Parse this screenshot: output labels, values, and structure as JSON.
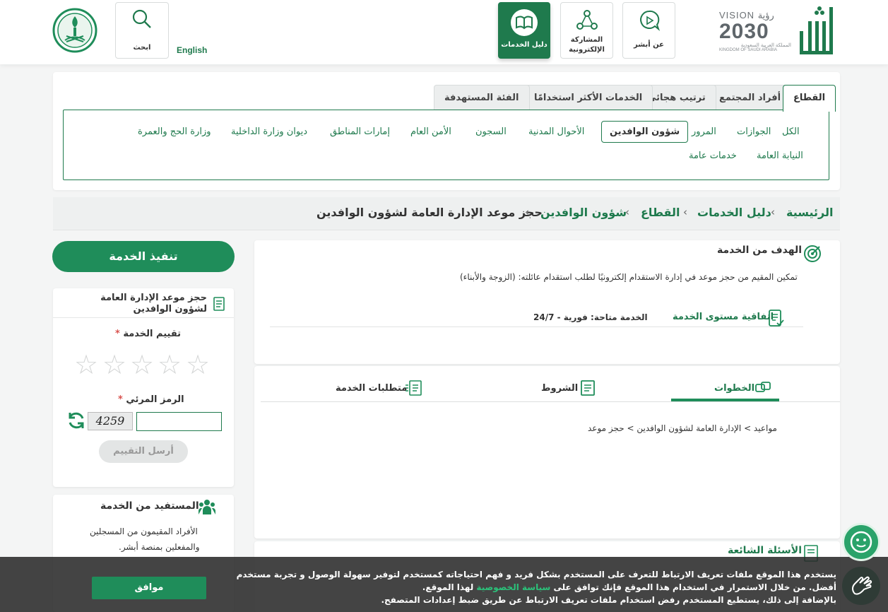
{
  "header": {
    "nav": {
      "about": "عن أبشر",
      "eparticipation": "المشاركة الإلكترونية",
      "services_guide": "دليل الخدمات",
      "search": "ابحث",
      "language": "English"
    },
    "vision": {
      "line1": "VISION رؤية",
      "line2": "2030",
      "line3": "المملكة العربية السعودية",
      "line4": "KINGDOM OF SAUDI ARABIA"
    }
  },
  "sector": {
    "tabs": [
      "القطاع",
      "أفراد المجتمع",
      "ترتيب هجائي",
      "الخدمات الأكثر استخدامًا",
      "الفئة المستهدفة"
    ],
    "chips_row1": [
      "الكل",
      "الجوازات",
      "المرور",
      "شؤون الوافدين",
      "الأحوال المدنية",
      "السجون",
      "الأمن العام",
      "إمارات المناطق",
      "ديوان وزارة الداخلية",
      "وزارة الحج والعمرة"
    ],
    "chips_row2": [
      "النيابة العامة",
      "خدمات عامة"
    ]
  },
  "breadcrumb": {
    "home": "الرئيسية",
    "guide": "دليل الخدمات",
    "sector": "القطاع",
    "expats": "شؤون الوافدين",
    "current": "حجز موعد الإدارة العامة لشؤون الوافدين",
    "sep": "›"
  },
  "sidebar": {
    "execute_label": "تنفيذ الخدمة",
    "rating_card_title": "حجز موعد الإدارة العامة لشؤون الوافدين",
    "rating_label": "تقييم الخدمة",
    "captcha_label": "الرمز المرئي",
    "captcha_text": "4259",
    "captcha_value": "",
    "send_label": "أرسل التقييم",
    "required_mark": "*",
    "beneficiary_title": "المستفيد من الخدمة",
    "beneficiary_line1": "الأفراد المقيمون من المسجلين",
    "beneficiary_line2": "والمفعلين بمنصة أبشر."
  },
  "main": {
    "goal_title": "الهدف من الخدمة",
    "goal_text": "تمكين المقيم من حجز موعد في إدارة الاستقدام إلكترونيًا لطلب استقدام عائلته: (الزوجة والأبناء)",
    "sla_label": "اتفاقية مستوى الخدمة",
    "availability": "الخدمة متاحة: فورية - 24/7",
    "tabs": {
      "steps": "الخطوات",
      "conditions": "الشروط",
      "requirements": "متطلبات الخدمة"
    },
    "steps_text": "مواعيد > الإدارة العامة لشؤون الوافدين > حجز موعد",
    "faq_title": "الأسئلة الشائعة"
  },
  "cookie": {
    "line1": "يستخدم هذا الموقع ملفات تعريف الارتباط للتعرف على المستخدم بشكل فريد و فهم احتياجاته كمستخدم لتوفير سهولة الوصول و تجربة مستخدم",
    "line2_a": "أفضل. من خلال الاستمرار في استخدام هذا الموقع فإنك توافق على",
    "line2_link": "سياسة الخصوصية",
    "line2_b": "لهذا الموقع.",
    "line3": "بالإضافة إلى ذلك، يستطيع المستخدم رفض استخدام ملفات تعريف الارتباط عن طريق ضبط إعدادات المتصفح.",
    "ok_label": "موافق"
  },
  "colors": {
    "primary": "#1f7a4d",
    "accent": "#1f8d5a"
  }
}
